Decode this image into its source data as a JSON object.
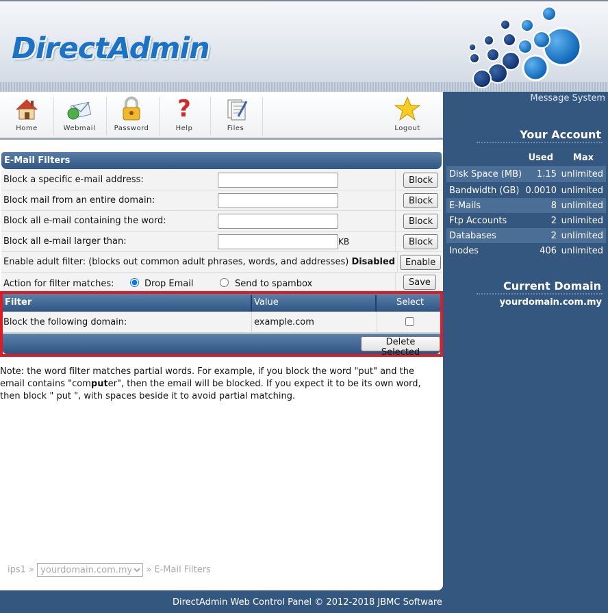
{
  "brand": {
    "logo_text": "DirectAdmin",
    "accent": "#1a73c6",
    "panel_blue": "#34577f",
    "highlight_red": "#e01b24"
  },
  "nav": {
    "items": [
      {
        "label": "Home",
        "icon": "home-icon"
      },
      {
        "label": "Webmail",
        "icon": "webmail-icon"
      },
      {
        "label": "Password",
        "icon": "lock-icon"
      },
      {
        "label": "Help",
        "icon": "help-icon"
      },
      {
        "label": "Files",
        "icon": "files-icon"
      },
      {
        "label": "Logout",
        "icon": "star-icon"
      }
    ]
  },
  "filters": {
    "title": "E-Mail Filters",
    "rows": [
      {
        "label": "Block a specific e-mail address:",
        "value": "",
        "button": "Block"
      },
      {
        "label": "Block mail from an entire domain:",
        "value": "",
        "button": "Block"
      },
      {
        "label": "Block all e-mail containing the word:",
        "value": "",
        "button": "Block"
      },
      {
        "label": "Block all e-mail larger than:",
        "value": "",
        "unit": "KB",
        "button": "Block"
      }
    ],
    "adult": {
      "label": "Enable adult filter: (blocks out common adult phrases, words, and addresses)",
      "status": "Disabled",
      "button": "Enable"
    },
    "action": {
      "label": "Action for filter matches:",
      "option_drop": "Drop Email",
      "option_spam": "Send to spambox",
      "selected": "Drop Email",
      "button": "Save"
    }
  },
  "table": {
    "headers": [
      "Filter",
      "Value",
      "Select"
    ],
    "rows": [
      {
        "filter": "Block the following domain:",
        "value": "example.com",
        "selected": false
      }
    ],
    "delete_button": "Delete Selected"
  },
  "note": {
    "part1": "Note: the word filter matches partial words. For example, if you block the word \"put\" and the email contains \"com",
    "bold": "put",
    "part2": "er\", then the email will be blocked. If you expect it to be its own word, then block \" put \", with spaces beside it to avoid partial matching."
  },
  "breadcrumb": {
    "server": "ips1",
    "sep": "»",
    "domain": "yourdomain.com.my",
    "page": "» E-Mail Filters"
  },
  "footer": "DirectAdmin Web Control Panel © 2012-2018 JBMC Software",
  "sidebar": {
    "message_system": "Message System",
    "account_title": "Your Account",
    "headers": {
      "used": "Used",
      "max": "Max"
    },
    "stats": [
      {
        "name": "Disk Space (MB)",
        "used": "1.15",
        "max": "unlimited"
      },
      {
        "name": "Bandwidth (GB)",
        "used": "0.0010",
        "max": "unlimited"
      },
      {
        "name": "E-Mails",
        "used": "8",
        "max": "unlimited"
      },
      {
        "name": "Ftp Accounts",
        "used": "2",
        "max": "unlimited"
      },
      {
        "name": "Databases",
        "used": "2",
        "max": "unlimited"
      },
      {
        "name": "Inodes",
        "used": "406",
        "max": "unlimited"
      }
    ],
    "domain_title": "Current Domain",
    "domain": "yourdomain.com.my"
  }
}
